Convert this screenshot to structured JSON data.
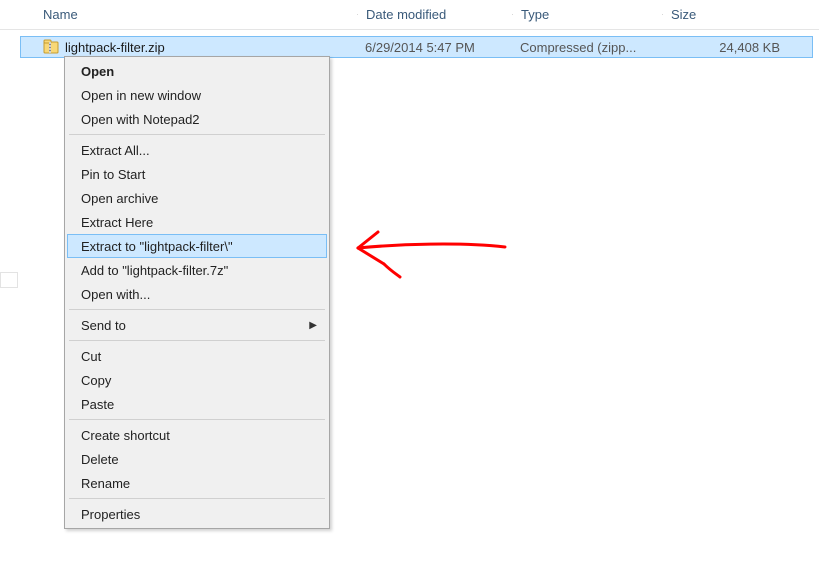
{
  "columns": {
    "name": "Name",
    "date": "Date modified",
    "type": "Type",
    "size": "Size"
  },
  "file": {
    "name": "lightpack-filter.zip",
    "date": "6/29/2014 5:47 PM",
    "type": "Compressed (zipp...",
    "size": "24,408 KB"
  },
  "menu": {
    "open": "Open",
    "open_new_window": "Open in new window",
    "open_notepad2": "Open with Notepad2",
    "extract_all": "Extract All...",
    "pin_to_start": "Pin to Start",
    "open_archive": "Open archive",
    "extract_here": "Extract Here",
    "extract_to_folder": "Extract to \"lightpack-filter\\\"",
    "add_to_7z": "Add to \"lightpack-filter.7z\"",
    "open_with": "Open with...",
    "send_to": "Send to",
    "cut": "Cut",
    "copy": "Copy",
    "paste": "Paste",
    "create_shortcut": "Create shortcut",
    "delete": "Delete",
    "rename": "Rename",
    "properties": "Properties"
  }
}
